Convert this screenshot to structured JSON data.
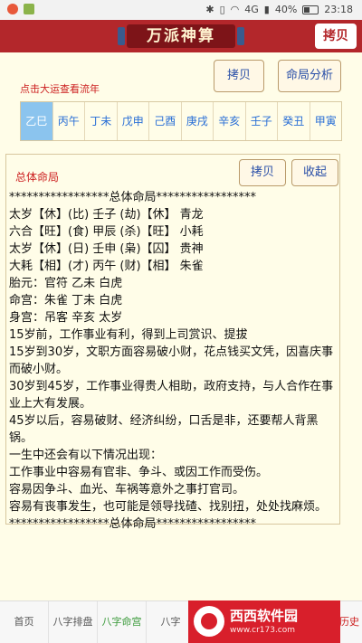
{
  "status_bar": {
    "battery": "40%",
    "time": "23:18",
    "network": "4G"
  },
  "header": {
    "app_title": "万派神算",
    "copy_label": "拷贝"
  },
  "toolbar": {
    "copy_label": "拷贝",
    "analysis_label": "命局分析"
  },
  "hint": "点击大运查看流年",
  "dayun_tabs": [
    "乙巳",
    "丙午",
    "丁未",
    "戊申",
    "己酉",
    "庚戌",
    "辛亥",
    "壬子",
    "癸丑",
    "甲寅"
  ],
  "panel": {
    "title": "总体命局",
    "copy_label": "拷贝",
    "collapse_label": "收起",
    "lines": [
      "*****************总体命局*****************",
      "太岁【休】(比) 壬子 (劫)【休】 青龙",
      "六合【旺】(食) 甲辰 (杀)【旺】 小耗",
      "太岁【休】(日) 壬申 (枭)【囚】 贵神",
      "大耗【相】(才) 丙午 (财)【相】 朱雀",
      "胎元：官符 乙未 白虎",
      "命宫：朱雀 丁未 白虎",
      "身宫：吊客 辛亥 太岁",
      "15岁前，工作事业有利，得到上司赏识、提拔",
      "15岁到30岁，文职方面容易破小财，花点钱买文凭，因喜庆事而破小财。",
      "30岁到45岁，工作事业得贵人相助，政府支持，与人合作在事业上大有发展。",
      "45岁以后，容易破财、经济纠纷，口舌是非，还要帮人背黑锅。",
      "一生中还会有以下情况出现：",
      "工作事业中容易有官非、争斗、或因工作而受伤。",
      "容易因争斗、血光、车祸等意外之事打官司。",
      "容易有丧事发生，也可能是领导找碴、找别扭，处处找麻烦。",
      "*****************总体命局*****************"
    ]
  },
  "bottom_nav": [
    "首页",
    "八字排盘",
    "八字命宫",
    "八字",
    "历史"
  ],
  "watermark": {
    "brand": "西西软件园",
    "url": "www.cr173.com"
  },
  "colors": {
    "header_red": "#b3272b",
    "tab_active": "#8bc4ee",
    "link_blue": "#2a4fa8",
    "accent_red": "#cc1f1f",
    "background": "#fffde8"
  }
}
